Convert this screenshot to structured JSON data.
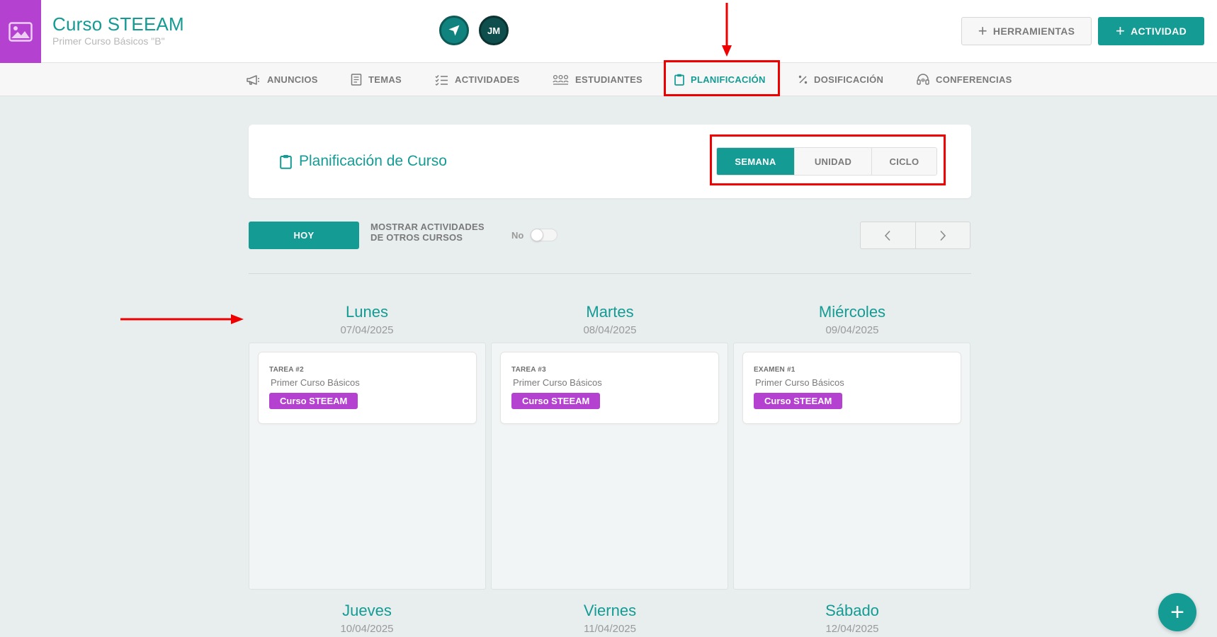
{
  "header": {
    "course_title": "Curso STEEAM",
    "course_subtitle": "Primer Curso Básicos \"B\"",
    "avatar_initials": "JM",
    "tools_label": "HERRAMIENTAS",
    "activity_label": "ACTIVIDAD"
  },
  "tabs": [
    {
      "label": "ANUNCIOS",
      "icon": "megaphone-icon"
    },
    {
      "label": "TEMAS",
      "icon": "document-icon"
    },
    {
      "label": "ACTIVIDADES",
      "icon": "checklist-icon"
    },
    {
      "label": "ESTUDIANTES",
      "icon": "students-icon"
    },
    {
      "label": "PLANIFICACIÓN",
      "icon": "clipboard-icon",
      "active": true
    },
    {
      "label": "DOSIFICACIÓN",
      "icon": "percent-icon"
    },
    {
      "label": "CONFERENCIAS",
      "icon": "headset-icon"
    }
  ],
  "planning": {
    "title": "Planificación de Curso",
    "views": [
      "SEMANA",
      "UNIDAD",
      "CICLO"
    ],
    "selected_view": "SEMANA"
  },
  "controls": {
    "today_label": "HOY",
    "show_other_label": "MOSTRAR ACTIVIDADES DE OTROS CURSOS",
    "toggle_value": "No"
  },
  "days": [
    {
      "name": "Lunes",
      "date": "07/04/2025",
      "activity": {
        "kind": "TAREA #2",
        "course": "Primer Curso Básicos",
        "tag": "Curso STEEAM"
      }
    },
    {
      "name": "Martes",
      "date": "08/04/2025",
      "activity": {
        "kind": "TAREA #3",
        "course": "Primer Curso Básicos",
        "tag": "Curso STEEAM"
      }
    },
    {
      "name": "Miércoles",
      "date": "09/04/2025",
      "activity": {
        "kind": "EXAMEN #1",
        "course": "Primer Curso Básicos",
        "tag": "Curso STEEAM"
      }
    },
    {
      "name": "Jueves",
      "date": "10/04/2025"
    },
    {
      "name": "Viernes",
      "date": "11/04/2025"
    },
    {
      "name": "Sábado",
      "date": "12/04/2025"
    }
  ],
  "colors": {
    "accent": "#139b94",
    "tag": "#b541d0",
    "annotation": "#ee0000",
    "background": "#e8eded"
  }
}
